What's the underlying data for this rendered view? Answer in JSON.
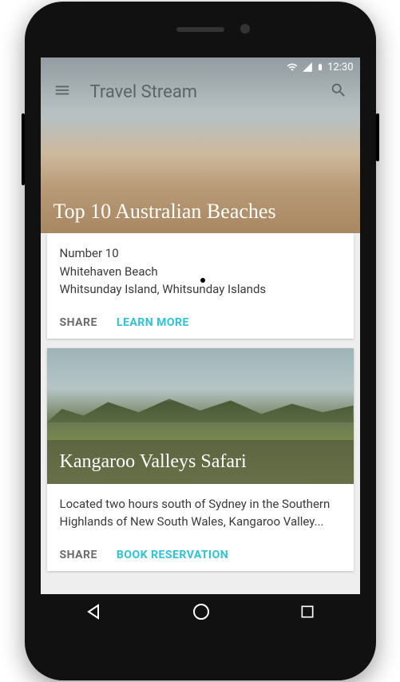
{
  "statusbar": {
    "time": "12:30"
  },
  "appbar": {
    "title": "Travel Stream"
  },
  "cards": [
    {
      "hero_title": "Top 10 Australian Beaches",
      "lines": [
        "Number 10",
        "Whitehaven Beach",
        "Whitsunday Island, Whitsunday Islands"
      ],
      "share": "SHARE",
      "primary": "LEARN MORE"
    },
    {
      "image_title": "Kangaroo Valleys Safari",
      "body": "Located two hours south of Sydney in the Southern Highlands of New South Wales, Kangaroo Valley...",
      "share": "SHARE",
      "primary": "BOOK RESERVATION"
    }
  ]
}
